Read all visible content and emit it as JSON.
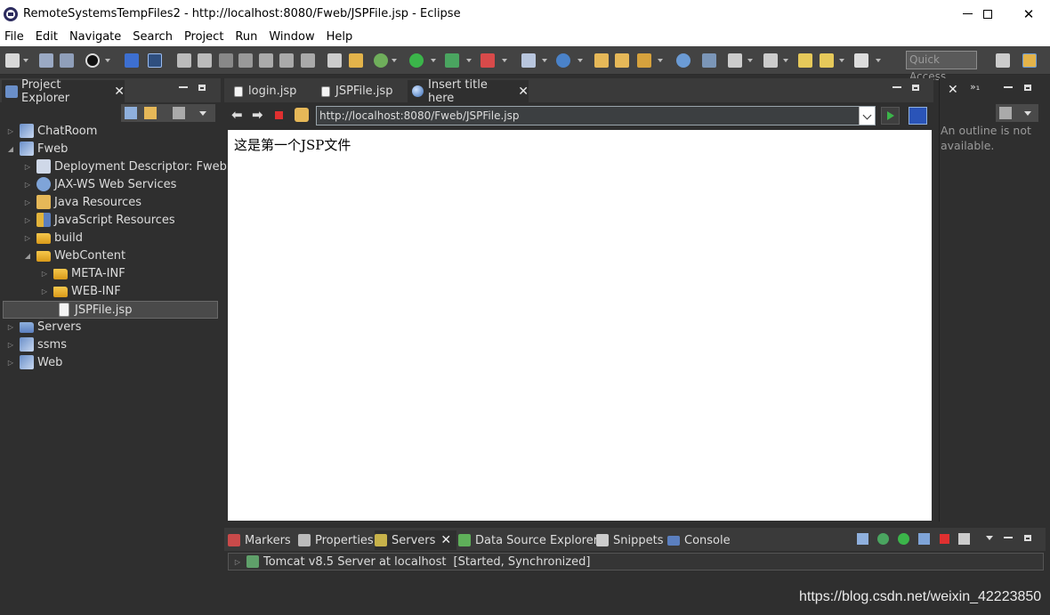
{
  "window": {
    "title": "RemoteSystemsTempFiles2 - http://localhost:8080/Fweb/JSPFile.jsp - Eclipse",
    "minimize": "—",
    "maximize": "☐",
    "close": "✕"
  },
  "menu": [
    "File",
    "Edit",
    "Navigate",
    "Search",
    "Project",
    "Run",
    "Window",
    "Help"
  ],
  "toolbar": {
    "quick_access_placeholder": "Quick Access"
  },
  "project_explorer": {
    "tab_label": "Project Explorer",
    "tree": [
      {
        "label": "ChatRoom",
        "expanded": false,
        "icon": "project-icon"
      },
      {
        "label": "Fweb",
        "expanded": true,
        "icon": "project-icon"
      },
      {
        "label": "Deployment Descriptor: Fweb",
        "expanded": false,
        "icon": "descriptor-icon"
      },
      {
        "label": "JAX-WS Web Services",
        "expanded": false,
        "icon": "webservices-icon"
      },
      {
        "label": "Java Resources",
        "expanded": false,
        "icon": "java-resources-icon"
      },
      {
        "label": "JavaScript Resources",
        "expanded": false,
        "icon": "javascript-resources-icon"
      },
      {
        "label": "build",
        "expanded": false,
        "icon": "folder-icon"
      },
      {
        "label": "WebContent",
        "expanded": true,
        "icon": "folder-icon"
      },
      {
        "label": "META-INF",
        "expanded": false,
        "icon": "folder-icon"
      },
      {
        "label": "WEB-INF",
        "expanded": false,
        "icon": "folder-icon"
      },
      {
        "label": "JSPFile.jsp",
        "selected": true,
        "icon": "file-icon"
      },
      {
        "label": "Servers",
        "expanded": false,
        "icon": "folder-icon"
      },
      {
        "label": "ssms",
        "expanded": false,
        "icon": "project-icon"
      },
      {
        "label": "Web",
        "expanded": false,
        "icon": "project-icon"
      }
    ]
  },
  "editor": {
    "tabs": [
      {
        "label": "login.jsp",
        "active": false
      },
      {
        "label": "JSPFile.jsp",
        "active": false
      },
      {
        "label": "Insert title here",
        "active": true
      }
    ],
    "url": "http://localhost:8080/Fweb/JSPFile.jsp",
    "page_text": "这是第一个JSP文件"
  },
  "outline": {
    "message": "An outline is not available."
  },
  "bottom": {
    "tabs": [
      {
        "label": "Markers",
        "active": false
      },
      {
        "label": "Properties",
        "active": false
      },
      {
        "label": "Servers",
        "active": true
      },
      {
        "label": "Data Source Explorer",
        "active": false
      },
      {
        "label": "Snippets",
        "active": false
      },
      {
        "label": "Console",
        "active": false
      }
    ],
    "server": {
      "name": "Tomcat v8.5 Server at localhost",
      "status": "[Started, Synchronized]"
    }
  },
  "watermark": "https://blog.csdn.net/weixin_42223850",
  "colors": {
    "toolbar_bg": "#434343",
    "panel_bg": "#2f2f2f",
    "selection": "#4a4a4a",
    "accent_green": "#3bb54a",
    "accent_red": "#e03030"
  }
}
